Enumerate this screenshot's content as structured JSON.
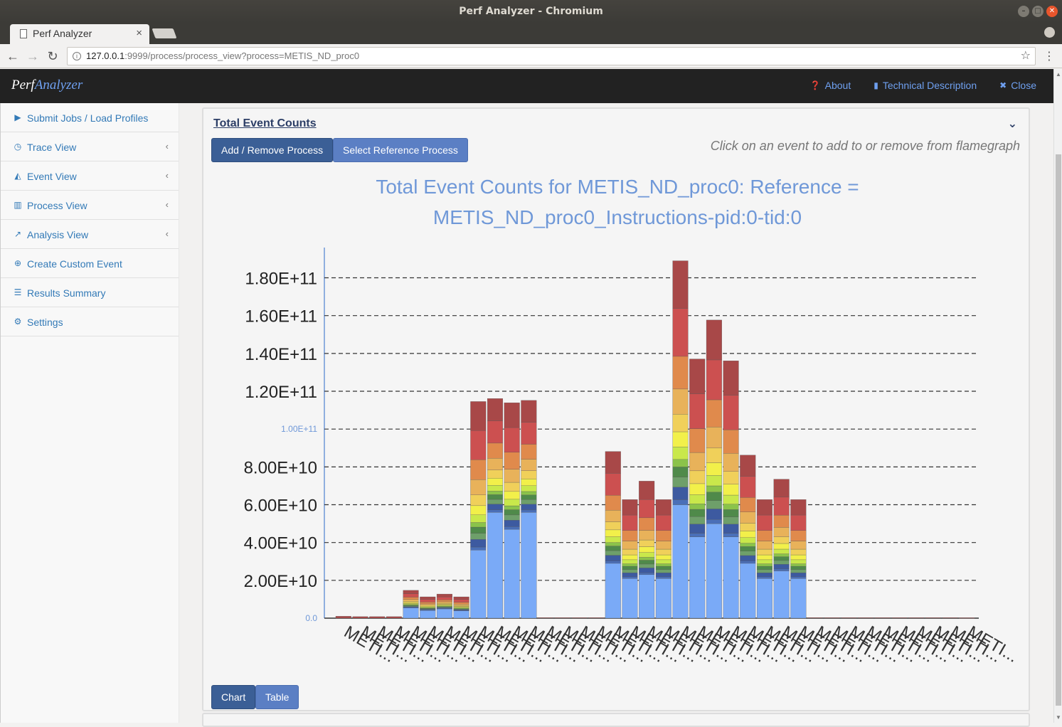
{
  "window": {
    "title": "Perf Analyzer - Chromium"
  },
  "browser": {
    "tab_title": "Perf Analyzer",
    "url_host": "127.0.0.1",
    "url_rest": ":9999/process/process_view?process=METIS_ND_proc0"
  },
  "navbar": {
    "brand_a": "Perf",
    "brand_b": "Analyzer",
    "links": [
      {
        "label": "About",
        "icon": "question-circle-icon"
      },
      {
        "label": "Technical Description",
        "icon": "book-icon"
      },
      {
        "label": "Close",
        "icon": "close-icon"
      }
    ]
  },
  "sidebar": {
    "items": [
      {
        "label": "Submit Jobs / Load Profiles",
        "icon": "play-icon",
        "submenu": false
      },
      {
        "label": "Trace View",
        "icon": "clock-icon",
        "submenu": true
      },
      {
        "label": "Event View",
        "icon": "area-chart-icon",
        "submenu": true
      },
      {
        "label": "Process View",
        "icon": "bar-chart-icon",
        "submenu": true
      },
      {
        "label": "Analysis View",
        "icon": "line-chart-icon",
        "submenu": true
      },
      {
        "label": "Create Custom Event",
        "icon": "plus-circle-icon",
        "submenu": false
      },
      {
        "label": "Results Summary",
        "icon": "list-icon",
        "submenu": false
      },
      {
        "label": "Settings",
        "icon": "gear-icon",
        "submenu": false
      }
    ]
  },
  "panel": {
    "title": "Total Event Counts",
    "add_remove_label": "Add / Remove Process",
    "select_ref_label": "Select Reference Process",
    "hint": "Click on an event to add to or remove from flamegraph",
    "chart_btn": "Chart",
    "table_btn": "Table"
  },
  "chart_data": {
    "type": "bar",
    "stacked": true,
    "title_line1": "Total Event Counts for METIS_ND_proc0: Reference =",
    "title_line2": "METIS_ND_proc0_Instructions-pid:0-tid:0",
    "y_tick_labels": [
      "0.0",
      "2.00E+10",
      "4.00E+10",
      "6.00E+10",
      "8.00E+10",
      "1.00E+11",
      "1.20E+11",
      "1.40E+11",
      "1.60E+11",
      "1.80E+11"
    ],
    "y_ticks": [
      0,
      20000000000,
      40000000000,
      60000000000,
      80000000000,
      100000000000,
      120000000000,
      140000000000,
      160000000000,
      180000000000
    ],
    "ylim": [
      0,
      196000000000
    ],
    "grid": true,
    "x_tick_label": "METI...",
    "x_tick_count": 38,
    "series_colors": [
      "#7aaaf7",
      "#4a6fb8",
      "#3d5aa0",
      "#6e9f6a",
      "#4f8a4a",
      "#8bc34a",
      "#c9e84b",
      "#f2f04a",
      "#f0d05a",
      "#e8b25a",
      "#e08a4c",
      "#cc5050",
      "#a84848"
    ],
    "category_totals": [
      1000000000,
      800000000,
      800000000,
      800000000,
      15000000000,
      11500000000,
      13000000000,
      11500000000,
      117000000000,
      118000000000,
      116000000000,
      117000000000,
      300000000,
      300000000,
      300000000,
      300000000,
      90000000000,
      64000000000,
      74000000000,
      64000000000,
      193000000000,
      140000000000,
      161000000000,
      139000000000,
      88000000000,
      64000000000,
      75000000000,
      64000000000,
      300000000,
      300000000,
      300000000,
      300000000,
      300000000,
      300000000,
      300000000,
      300000000,
      300000000,
      200000000
    ],
    "category_base": [
      0,
      0,
      0,
      0,
      5500000000,
      4200000000,
      5000000000,
      4000000000,
      36000000000,
      56000000000,
      47000000000,
      56000000000,
      0,
      0,
      0,
      0,
      29000000000,
      21000000000,
      23000000000,
      21000000000,
      60000000000,
      43000000000,
      50000000000,
      43000000000,
      29000000000,
      21000000000,
      25000000000,
      21000000000,
      0,
      0,
      0,
      0,
      0,
      0,
      0,
      0,
      0,
      0
    ]
  }
}
